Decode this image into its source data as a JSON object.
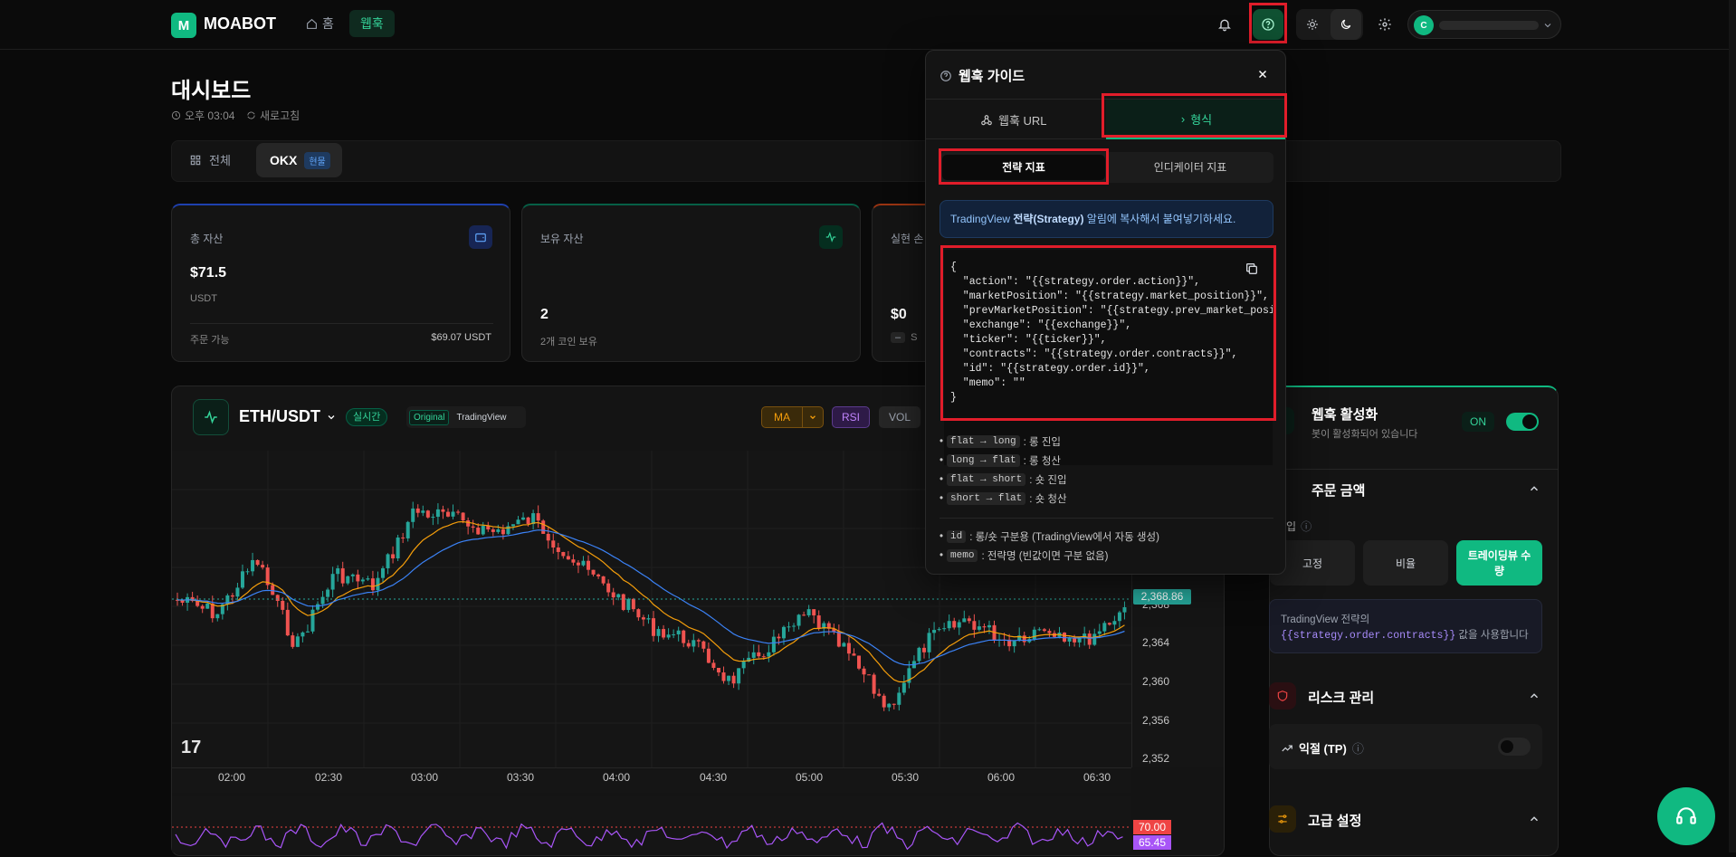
{
  "brand": {
    "logo_letter": "M",
    "name": "MOABOT"
  },
  "nav": {
    "home": "홈",
    "webhook": "웹훅"
  },
  "user": {
    "avatar": "C"
  },
  "page": {
    "title": "대시보드",
    "time": "오후 03:04",
    "refresh": "새로고침"
  },
  "tabs": {
    "all": "전체",
    "okx": "OKX",
    "okx_badge": "현물"
  },
  "cards": [
    {
      "label": "총 자산",
      "value": "$71.5",
      "unit": "USDT",
      "foot_label": "주문 가능",
      "foot_value": "$69.07 USDT"
    },
    {
      "label": "보유 자산",
      "value": "2",
      "foot_label": "2개 코인 보유"
    },
    {
      "label": "실현 손",
      "value": "$0",
      "foot_label": "S"
    }
  ],
  "chart": {
    "pair": "ETH/USDT",
    "live": "실시간",
    "mode_original": "Original",
    "mode_tv": "TradingView",
    "ma": "MA",
    "rsi": "RSI",
    "vol": "VOL",
    "last_price": "2,368.86",
    "rsi_level": "70.00",
    "rsi_value": "65.45"
  },
  "chart_data": {
    "type": "candlestick",
    "x_ticks": [
      "02:00",
      "02:30",
      "03:00",
      "03:30",
      "04:00",
      "04:30",
      "05:00",
      "05:30",
      "06:00",
      "06:30"
    ],
    "y_ticks": [
      "2,368",
      "2,364",
      "2,360",
      "2,356",
      "2,352"
    ],
    "last_price": 2368.86,
    "rsi_level": 70.0,
    "rsi_value": 65.45
  },
  "modal": {
    "title": "웹훅 가이드",
    "tab_url": "웹훅 URL",
    "tab_format": "형식",
    "sub_strategy": "전략 지표",
    "sub_indicator": "인디케이터 지표",
    "info_pre": "TradingView ",
    "info_bold": "전략(Strategy)",
    "info_post": " 알림에 복사해서 붙여넣기하세요.",
    "code": "{\n  \"action\": \"{{strategy.order.action}}\",\n  \"marketPosition\": \"{{strategy.market_position}}\",\n  \"prevMarketPosition\": \"{{strategy.prev_market_position}}\",\n  \"exchange\": \"{{exchange}}\",\n  \"ticker\": \"{{ticker}}\",\n  \"contracts\": \"{{strategy.order.contracts}}\",\n  \"id\": \"{{strategy.order.id}}\",\n  \"memo\": \"\"\n}",
    "rules": [
      {
        "chip": "flat → long",
        "text": ": 롱 진입"
      },
      {
        "chip": "long → flat",
        "text": ": 롱 청산"
      },
      {
        "chip": "flat → short",
        "text": ": 숏 진입"
      },
      {
        "chip": "short → flat",
        "text": ": 숏 청산"
      }
    ],
    "notes": [
      {
        "chip": "id",
        "text": ": 롱/숏 구분용 (TradingView에서 자동 생성)"
      },
      {
        "chip": "memo",
        "text": ": 전략명 (빈값이면 구분 없음)"
      }
    ]
  },
  "panel": {
    "activate_title": "웹훅 활성화",
    "activate_sub": "봇이 활성화되어 있습니다",
    "on": "ON",
    "order_amount": "주문 금액",
    "type_label": "타입",
    "opt_fixed": "고정",
    "opt_ratio": "비율",
    "opt_tv": "트레이딩뷰 수량",
    "tv_note_1": "TradingView 전략의",
    "tv_note_code": "{{strategy.order.contracts}}",
    "tv_note_2": " 값을 사용합니다",
    "risk": "리스크 관리",
    "tp": "익절 (TP)",
    "advanced": "고급 설정"
  }
}
